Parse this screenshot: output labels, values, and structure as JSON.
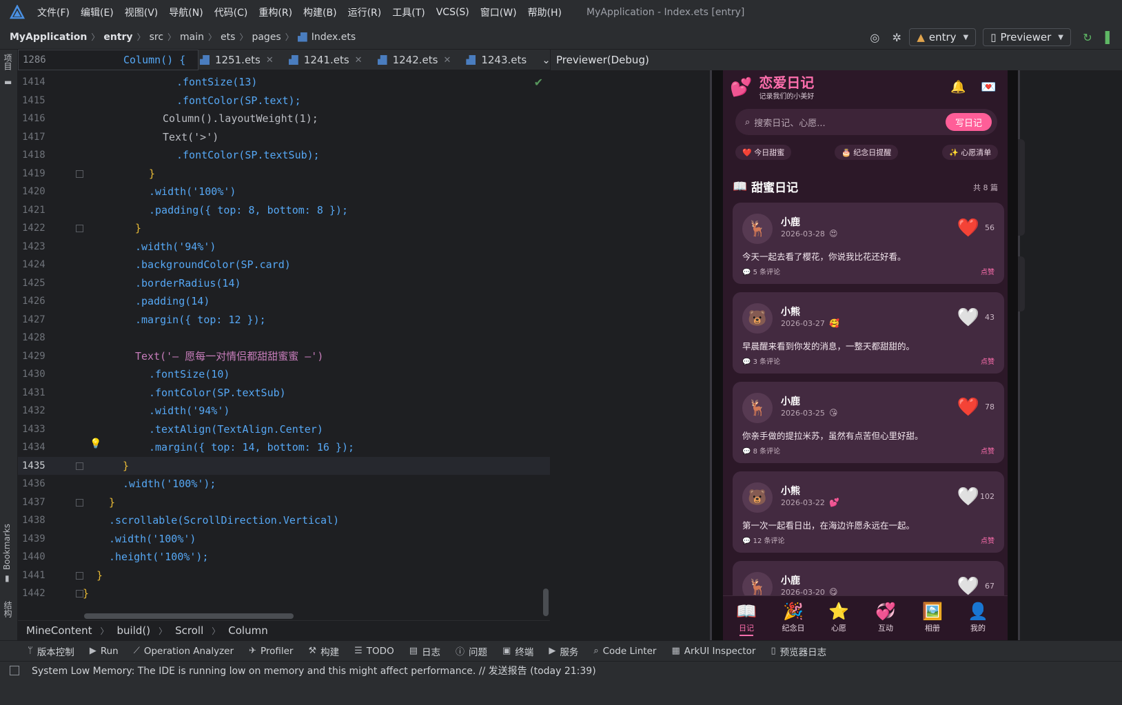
{
  "window": {
    "title": "MyApplication - Index.ets [entry]"
  },
  "menu": [
    "文件(F)",
    "编辑(E)",
    "视图(V)",
    "导航(N)",
    "代码(C)",
    "重构(R)",
    "构建(B)",
    "运行(R)",
    "工具(T)",
    "VCS(S)",
    "窗口(W)",
    "帮助(H)"
  ],
  "breadcrumb": {
    "project": "MyApplication",
    "module": "entry",
    "p1": "src",
    "p2": "main",
    "p3": "ets",
    "p4": "pages",
    "file": "Index.ets"
  },
  "toolbar": {
    "module_select": "entry",
    "previewer_select": "Previewer"
  },
  "left_strip": {
    "project": "项目",
    "bookmarks": "Bookmarks",
    "structure": "结构"
  },
  "editor": {
    "sticky": {
      "num": "1286",
      "code": "Column() {"
    },
    "tabs": [
      {
        "label": "1251.ets"
      },
      {
        "label": "1241.ets"
      },
      {
        "label": "1242.ets"
      },
      {
        "label": "1243.ets"
      }
    ],
    "lines": [
      {
        "num": "1414",
        "indent": 230,
        "code": ".fontSize(13)"
      },
      {
        "num": "1415",
        "indent": 230,
        "code": ".fontColor(SP.text);"
      },
      {
        "num": "1416",
        "indent": 210,
        "code": "Column().layoutWeight(1);"
      },
      {
        "num": "1417",
        "indent": 210,
        "code": "Text('>')"
      },
      {
        "num": "1418",
        "indent": 230,
        "code": ".fontColor(SP.textSub);"
      },
      {
        "num": "1419",
        "indent": 190,
        "code": "}"
      },
      {
        "num": "1420",
        "indent": 190,
        "code": ".width('100%')"
      },
      {
        "num": "1421",
        "indent": 190,
        "code": ".padding({ top: 8, bottom: 8 });"
      },
      {
        "num": "1422",
        "indent": 170,
        "code": "}"
      },
      {
        "num": "1423",
        "indent": 170,
        "code": ".width('94%')"
      },
      {
        "num": "1424",
        "indent": 170,
        "code": ".backgroundColor(SP.card)"
      },
      {
        "num": "1425",
        "indent": 170,
        "code": ".borderRadius(14)"
      },
      {
        "num": "1426",
        "indent": 170,
        "code": ".padding(14)"
      },
      {
        "num": "1427",
        "indent": 170,
        "code": ".margin({ top: 12 });"
      },
      {
        "num": "1428",
        "indent": 170,
        "code": ""
      },
      {
        "num": "1429",
        "indent": 170,
        "code": "Text('— 愿每一对情侣都甜甜蜜蜜 —')"
      },
      {
        "num": "1430",
        "indent": 190,
        "code": ".fontSize(10)"
      },
      {
        "num": "1431",
        "indent": 190,
        "code": ".fontColor(SP.textSub)"
      },
      {
        "num": "1432",
        "indent": 190,
        "code": ".width('94%')"
      },
      {
        "num": "1433",
        "indent": 190,
        "code": ".textAlign(TextAlign.Center)"
      },
      {
        "num": "1434",
        "indent": 190,
        "code": ".margin({ top: 14, bottom: 16 });"
      },
      {
        "num": "1435",
        "indent": 152,
        "code": "}"
      },
      {
        "num": "1436",
        "indent": 152,
        "code": ".width('100%');"
      },
      {
        "num": "1437",
        "indent": 132,
        "code": "}"
      },
      {
        "num": "1438",
        "indent": 132,
        "code": ".scrollable(ScrollDirection.Vertical)"
      },
      {
        "num": "1439",
        "indent": 132,
        "code": ".width('100%')"
      },
      {
        "num": "1440",
        "indent": 132,
        "code": ".height('100%');"
      },
      {
        "num": "1441",
        "indent": 114,
        "code": "}"
      },
      {
        "num": "1442",
        "indent": 94,
        "code": "}"
      }
    ],
    "crumbs": [
      "MineContent",
      "build()",
      "Scroll",
      "Column"
    ]
  },
  "previewer": {
    "title": "Previewer(Debug)",
    "app": {
      "title": "恋爱日记",
      "subtitle": "记录我们的小美好",
      "search_placeholder": "搜索日记、心愿...",
      "write_button": "写日记",
      "chips": [
        "❤️ 今日甜蜜",
        "🎂 纪念日提醒",
        "✨ 心愿清单"
      ],
      "section_title": "甜蜜日记",
      "section_count": "共 8 篇",
      "cards": [
        {
          "avatar": "🦌",
          "name": "小鹿",
          "date": "2026-03-28",
          "mood": "😍",
          "heart": "❤️",
          "likes": "56",
          "text": "今天一起去看了樱花，你说我比花还好看。",
          "comments": "💬 5 条评论",
          "like_label": "点赞"
        },
        {
          "avatar": "🐻",
          "name": "小熊",
          "date": "2026-03-27",
          "mood": "🥰",
          "heart": "🤍",
          "likes": "43",
          "text": "早晨醒来看到你发的消息，一整天都甜甜的。",
          "comments": "💬 3 条评论",
          "like_label": "点赞"
        },
        {
          "avatar": "🦌",
          "name": "小鹿",
          "date": "2026-03-25",
          "mood": "😘",
          "heart": "❤️",
          "likes": "78",
          "text": "你亲手做的提拉米苏，虽然有点苦但心里好甜。",
          "comments": "💬 8 条评论",
          "like_label": "点赞"
        },
        {
          "avatar": "🐻",
          "name": "小熊",
          "date": "2026-03-22",
          "mood": "💕",
          "heart": "🤍",
          "likes": "102",
          "text": "第一次一起看日出，在海边许愿永远在一起。",
          "comments": "💬 12 条评论",
          "like_label": "点赞"
        },
        {
          "avatar": "🦌",
          "name": "小鹿",
          "date": "2026-03-20",
          "mood": "😋",
          "heart": "🤍",
          "likes": "67",
          "text": "",
          "comments": "",
          "like_label": ""
        }
      ],
      "tabs": [
        {
          "icon": "📖",
          "label": "日记"
        },
        {
          "icon": "🎉",
          "label": "纪念日"
        },
        {
          "icon": "⭐",
          "label": "心愿"
        },
        {
          "icon": "💞",
          "label": "互动"
        },
        {
          "icon": "🖼️",
          "label": "相册"
        },
        {
          "icon": "👤",
          "label": "我的"
        }
      ]
    }
  },
  "tool_windows": [
    "版本控制",
    "Run",
    "Operation Analyzer",
    "Profiler",
    "构建",
    "TODO",
    "日志",
    "问题",
    "终端",
    "服务",
    "Code Linter",
    "ArkUI Inspector",
    "预览器日志"
  ],
  "status": {
    "message": "System Low Memory: The IDE is running low on memory and this might affect performance. // 发送报告 (today 21:39)"
  },
  "colors": {
    "accent_pink": "#ff6fae",
    "app_bg": "#2c1828",
    "card_bg": "#432a40",
    "editor_bg": "#1e1f22"
  }
}
